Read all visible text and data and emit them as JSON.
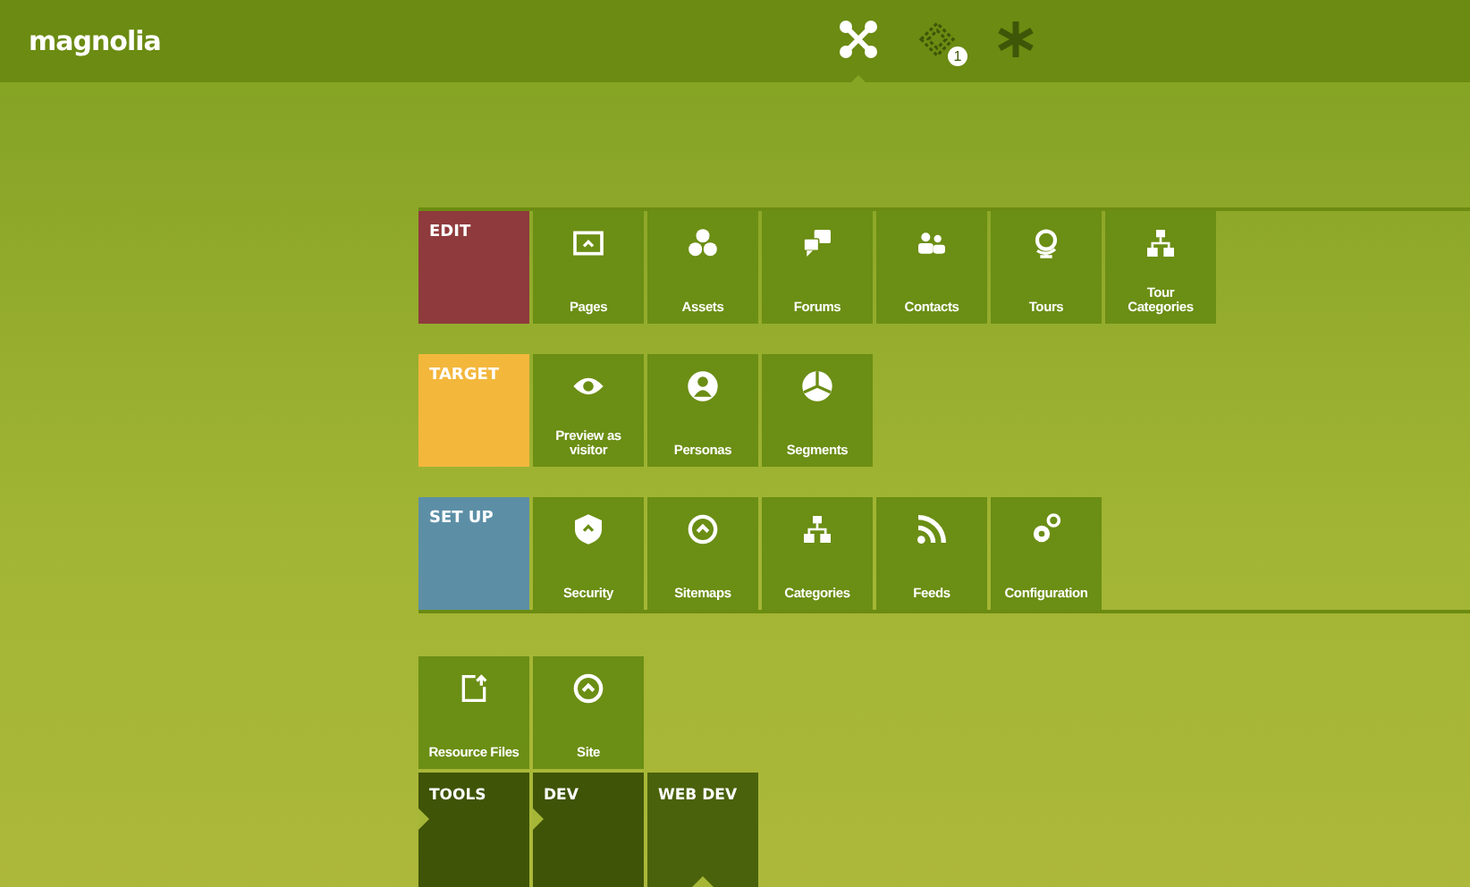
{
  "header": {
    "logo": "magnolia",
    "apps": [
      {
        "kind": "nodes",
        "selected": true
      },
      {
        "kind": "pulse",
        "selected": false,
        "badge": "1"
      },
      {
        "kind": "asterisk",
        "selected": false
      }
    ]
  },
  "groups": [
    {
      "label": "EDIT",
      "color": "#8f3a3c",
      "apps": [
        {
          "label": "Pages",
          "kind": "pages"
        },
        {
          "label": "Assets",
          "kind": "assets"
        },
        {
          "label": "Forums",
          "kind": "forums"
        },
        {
          "label": "Contacts",
          "kind": "contacts"
        },
        {
          "label": "Tours",
          "kind": "tours"
        },
        {
          "label": "Tour Categories",
          "kind": "tree"
        }
      ]
    },
    {
      "label": "TARGET",
      "color": "#f3b73c",
      "apps": [
        {
          "label": "Preview as visitor",
          "kind": "eye"
        },
        {
          "label": "Personas",
          "kind": "persona"
        },
        {
          "label": "Segments",
          "kind": "pie"
        }
      ]
    },
    {
      "label": "SET UP",
      "color": "#5c8fa6",
      "apps": [
        {
          "label": "Security",
          "kind": "shield"
        },
        {
          "label": "Sitemaps",
          "kind": "circle"
        },
        {
          "label": "Categories",
          "kind": "tree"
        },
        {
          "label": "Feeds",
          "kind": "rss"
        },
        {
          "label": "Configuration",
          "kind": "gears"
        }
      ]
    }
  ],
  "tools": {
    "apps": [
      {
        "label": "Resource Files",
        "kind": "file"
      },
      {
        "label": "Site",
        "kind": "circle"
      }
    ],
    "tabs": [
      {
        "label": "TOOLS",
        "selected": false
      },
      {
        "label": "DEV",
        "selected": false
      },
      {
        "label": "WEB DEV",
        "selected": true
      }
    ]
  }
}
